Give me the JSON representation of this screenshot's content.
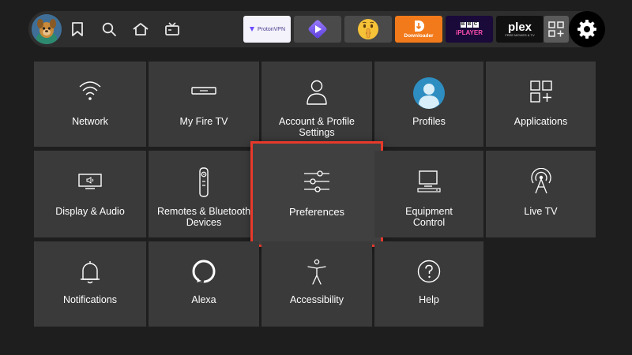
{
  "topbar": {
    "nav": [
      "avatar",
      "bookmark-icon",
      "search-icon",
      "home-icon",
      "live-tv-icon"
    ],
    "apps": [
      {
        "name": "protonvpn",
        "label": "ProtonVPN"
      },
      {
        "name": "player-app",
        "label": ""
      },
      {
        "name": "shush-app",
        "label": ""
      },
      {
        "name": "downloader",
        "label": "Downloader"
      },
      {
        "name": "bbc-iplayer",
        "label_top": "BBC",
        "label_bottom": "iPLAYER"
      },
      {
        "name": "plex",
        "label": "plex",
        "sub": "FREE MOVIES & TV"
      },
      {
        "name": "app-library",
        "label": ""
      }
    ],
    "colors": {
      "bar": "#2e2e2e",
      "settings": "#000000",
      "focus": "#e8392b"
    }
  },
  "grid": {
    "tiles": [
      {
        "id": "network",
        "label": "Network"
      },
      {
        "id": "my-fire-tv",
        "label": "My Fire TV"
      },
      {
        "id": "account-profile-settings",
        "label_l1": "Account & Profile",
        "label_l2": "Settings"
      },
      {
        "id": "profiles",
        "label": "Profiles"
      },
      {
        "id": "applications",
        "label": "Applications"
      },
      {
        "id": "display-audio",
        "label": "Display & Audio"
      },
      {
        "id": "remotes-bluetooth",
        "label_l1": "Remotes & Bluetooth",
        "label_l2": "Devices"
      },
      {
        "id": "preferences",
        "label": "Preferences"
      },
      {
        "id": "equipment-control",
        "label_l1": "Equipment",
        "label_l2": "Control"
      },
      {
        "id": "live-tv",
        "label": "Live TV"
      },
      {
        "id": "notifications",
        "label": "Notifications"
      },
      {
        "id": "alexa",
        "label": "Alexa"
      },
      {
        "id": "accessibility",
        "label": "Accessibility"
      },
      {
        "id": "help",
        "label": "Help"
      }
    ]
  }
}
